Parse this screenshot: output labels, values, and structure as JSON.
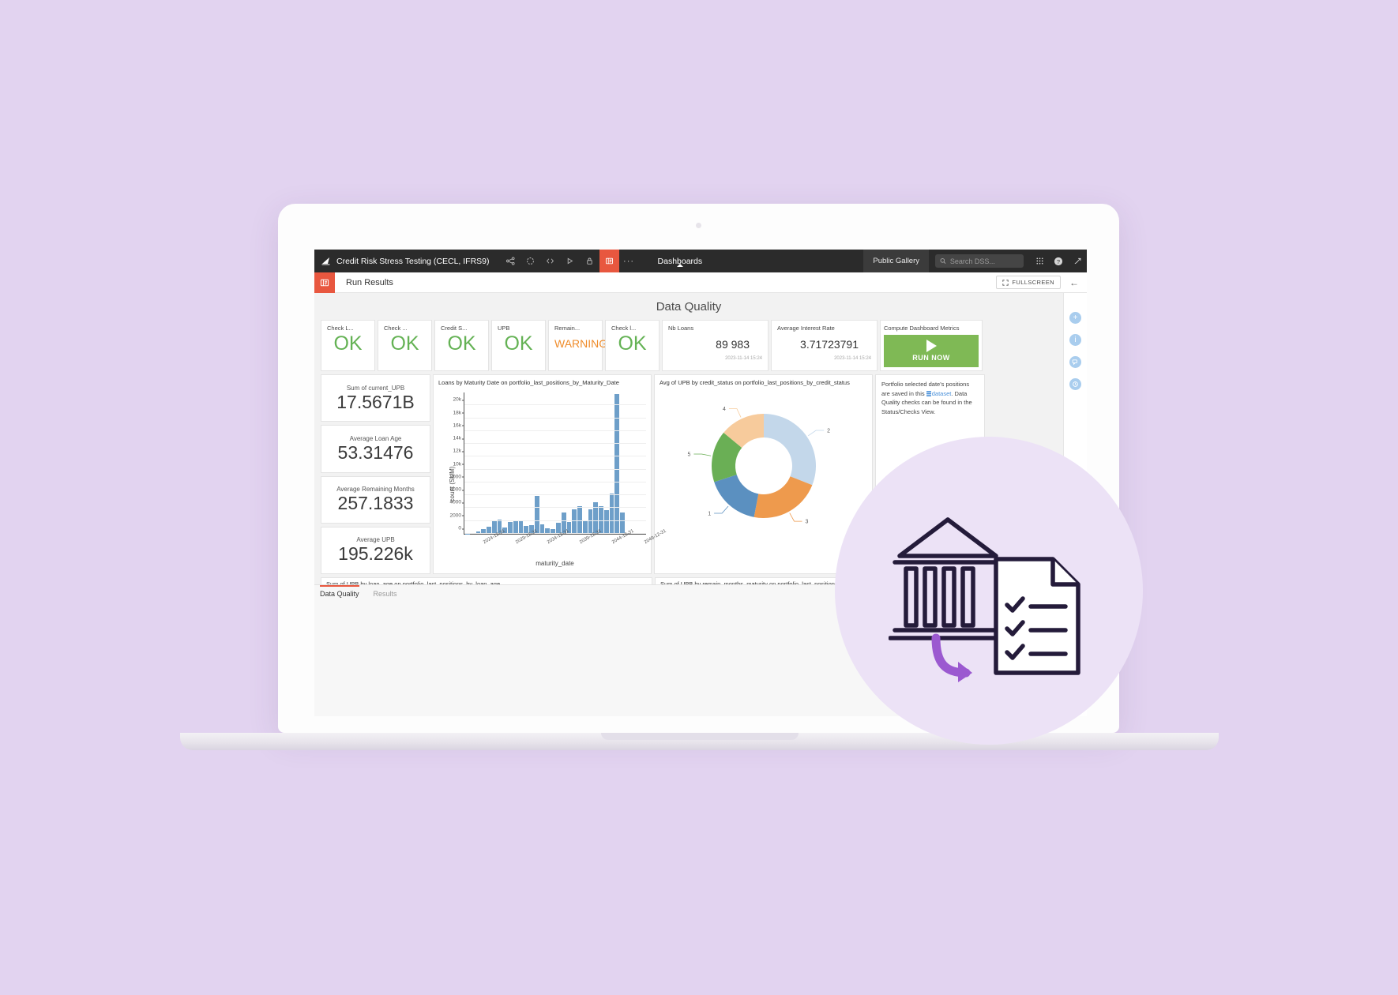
{
  "window": {
    "brand_icon": "dataiku-logo-icon",
    "project_title": "Credit Risk Stress Testing (CECL, IFRS9)",
    "nav_icons": [
      {
        "name": "share-icon",
        "glyph": "share"
      },
      {
        "name": "refresh-icon",
        "glyph": "refresh"
      },
      {
        "name": "code-icon",
        "glyph": "code"
      },
      {
        "name": "run-icon",
        "glyph": "play"
      },
      {
        "name": "lock-icon",
        "glyph": "lock"
      },
      {
        "name": "dashboard-icon",
        "glyph": "dashboard",
        "active": true
      }
    ],
    "more_dots": "···",
    "section_label": "Dashboards",
    "public_gallery_label": "Public Gallery",
    "search_placeholder": "Search DSS...",
    "apps_icon": "grid-apps-icon",
    "help_icon": "help-icon",
    "expand_icon": "trending-arrow-icon"
  },
  "subheader": {
    "badge_icon": "dashboard-badge-icon",
    "title": "Run Results",
    "fullscreen_label": "FULLSCREEN",
    "back_icon": "back-arrow-icon"
  },
  "dashboard": {
    "title": "Data Quality",
    "checks": [
      {
        "label": "Check L...",
        "status": "OK",
        "state": "ok"
      },
      {
        "label": "Check ...",
        "status": "OK",
        "state": "ok"
      },
      {
        "label": "Credit S...",
        "status": "OK",
        "state": "ok"
      },
      {
        "label": "UPB",
        "status": "OK",
        "state": "ok"
      },
      {
        "label": "Remain...",
        "status": "WARNING",
        "state": "warning"
      },
      {
        "label": "Check l...",
        "status": "OK",
        "state": "ok"
      }
    ],
    "kpis_top": [
      {
        "label": "Nb Loans",
        "value": "89 983",
        "timestamp": "2023-11-14 15:24"
      },
      {
        "label": "Average Interest Rate",
        "value": "3.71723791",
        "timestamp": "2023-11-14 15:24"
      }
    ],
    "compute": {
      "label": "Compute Dashboard Metrics",
      "button_label": "RUN NOW",
      "button_color": "#7fb955"
    },
    "kpis_left": [
      {
        "label": "Sum of current_UPB",
        "value": "17.5671B"
      },
      {
        "label": "Average Loan Age",
        "value": "53.31476"
      },
      {
        "label": "Average Remaining Months",
        "value": "257.1833"
      },
      {
        "label": "Average UPB",
        "value": "195.226k"
      }
    ],
    "note": {
      "line1": "Portfolio selected date's positions are",
      "line2_pre": "saved in this",
      "link": "dataset",
      "line2_post": ". Data Quality",
      "line3": "checks can be found in the",
      "line4": "Status/Checks View."
    },
    "bottom_panels": [
      {
        "title": "Sum of UPB by loan_age on portfolio_last_positions_by_loan_age"
      },
      {
        "title": "Sum of UPB by remain_months_maturity on portfolio_last_positions_by_remaining_dur"
      }
    ],
    "tabs": [
      {
        "label": "Data Quality",
        "active": true
      },
      {
        "label": "Results",
        "active": false
      }
    ],
    "rail_icons": [
      "plus-circle-icon",
      "info-circle-icon",
      "comment-circle-icon",
      "history-circle-icon"
    ]
  },
  "chart_data": [
    {
      "type": "bar",
      "title": "Loans by Maturity Date on portfolio_last_positions_by_Maturity_Date",
      "xlabel": "maturity_date",
      "ylabel": "count (SUM)",
      "ylim": [
        0,
        22000
      ],
      "yticks": [
        "0",
        "2000",
        "4000",
        "6000",
        "8000",
        "10k",
        "12k",
        "14k",
        "16k",
        "18k",
        "20k"
      ],
      "ytick_values": [
        0,
        2000,
        4000,
        6000,
        8000,
        10000,
        12000,
        14000,
        16000,
        18000,
        20000
      ],
      "grid": true,
      "xtick_labels": [
        "2024-12-31",
        "2029-12-31",
        "2034-12-31",
        "2039-12-31",
        "2044-12-31",
        "2049-12-31"
      ],
      "xtick_indices": [
        3,
        9,
        15,
        21,
        27,
        33
      ],
      "categories": [
        "2021-12-31",
        "2022-12-31",
        "2023-12-31",
        "2024-12-31",
        "2025-12-31",
        "2026-12-31",
        "2027-12-31",
        "2028-12-31",
        "2029-12-31",
        "2030-12-31",
        "2031-12-31",
        "2032-12-31",
        "2033-12-31",
        "2034-12-31",
        "2035-12-31",
        "2036-12-31",
        "2037-12-31",
        "2038-12-31",
        "2039-12-31",
        "2040-12-31",
        "2041-12-31",
        "2042-12-31",
        "2043-12-31",
        "2044-12-31",
        "2045-12-31",
        "2046-12-31",
        "2047-12-31",
        "2048-12-31",
        "2049-12-31",
        "2050-12-31",
        "2051-12-31",
        "2052-12-31",
        "2053-12-31",
        "2054-12-31"
      ],
      "values": [
        60,
        160,
        360,
        760,
        1120,
        2020,
        2250,
        1020,
        1900,
        2100,
        1950,
        1220,
        1380,
        5880,
        1500,
        900,
        760,
        1780,
        3360,
        1800,
        3760,
        4340,
        2100,
        3830,
        4900,
        4260,
        3700,
        6250,
        21700,
        3260,
        0,
        0,
        0,
        0
      ],
      "bar_color": "#6e9fc9"
    },
    {
      "type": "pie",
      "title": "Avg of UPB by credit_status on portfolio_last_positions_by_credit_status",
      "donut": true,
      "labels": [
        "2",
        "3",
        "1",
        "5",
        "4"
      ],
      "values": [
        31,
        22,
        17,
        16,
        14
      ],
      "colors": [
        "#c3d7ea",
        "#ee9a4d",
        "#5b90c0",
        "#6aaf55",
        "#f7cb9c"
      ]
    }
  ]
}
